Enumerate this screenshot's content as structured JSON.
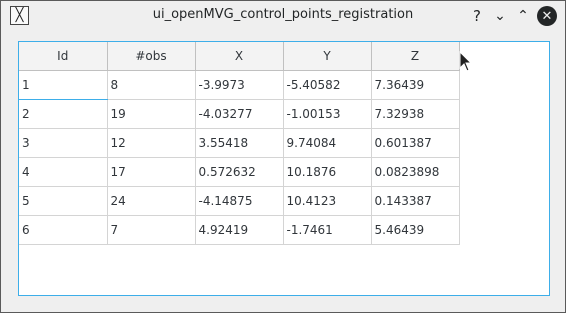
{
  "window": {
    "title": "ui_openMVG_control_points_registration",
    "help_label": "?",
    "min_label": "⌄",
    "max_label": "⌃",
    "close_label": "✕",
    "app_icon_label": "╳"
  },
  "table": {
    "headers": [
      "Id",
      "#obs",
      "X",
      "Y",
      "Z"
    ],
    "rows": [
      [
        "1",
        "8",
        "-3.9973",
        "-5.40582",
        "7.36439"
      ],
      [
        "2",
        "19",
        "-4.03277",
        "-1.00153",
        "7.32938"
      ],
      [
        "3",
        "12",
        "3.55418",
        "9.74084",
        "0.601387"
      ],
      [
        "4",
        "17",
        "0.572632",
        "10.1876",
        "0.0823898"
      ],
      [
        "5",
        "24",
        "-4.14875",
        "10.4123",
        "0.143387"
      ],
      [
        "6",
        "7",
        "4.92419",
        "-1.7461",
        "5.46439"
      ]
    ]
  }
}
